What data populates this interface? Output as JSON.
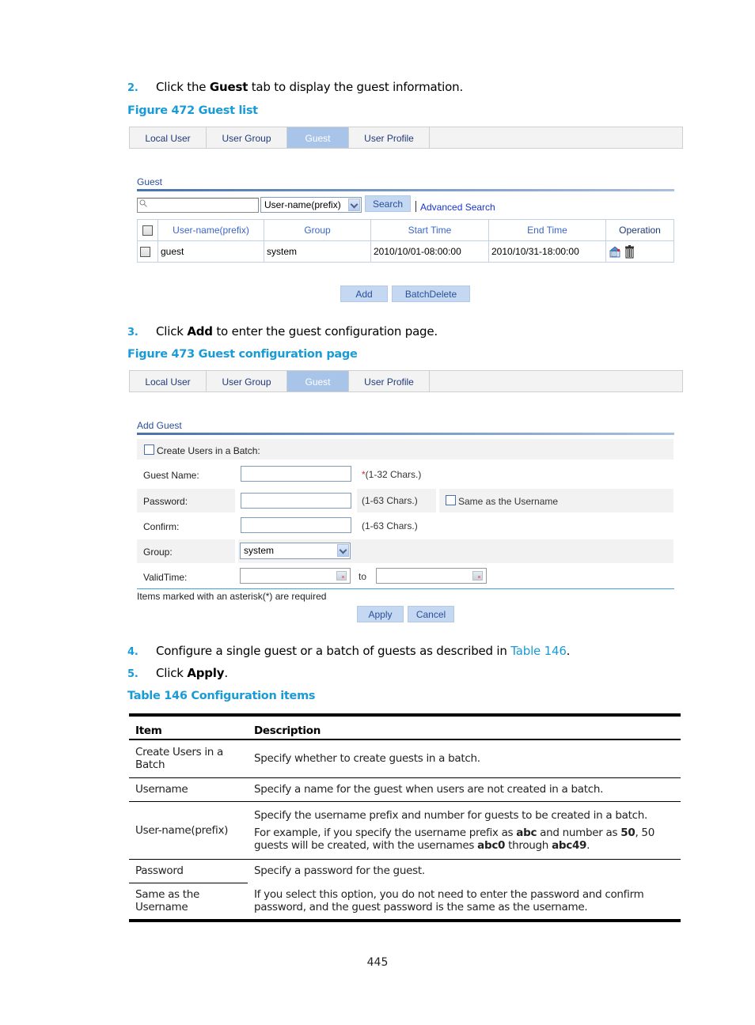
{
  "steps": {
    "s2": {
      "num": "2.",
      "pre": "Click the ",
      "bold": "Guest",
      "post": " tab to display the guest information."
    },
    "s3": {
      "num": "3.",
      "pre": "Click ",
      "bold": "Add",
      "post": " to enter the guest configuration page."
    },
    "s4": {
      "num": "4.",
      "pre": "Configure a single guest or a batch of guests as described in ",
      "link": "Table 146",
      "post": "."
    },
    "s5": {
      "num": "5.",
      "pre": "Click ",
      "bold": "Apply",
      "post": "."
    }
  },
  "captions": {
    "fig472": "Figure 472 Guest list",
    "fig473": "Figure 473 Guest configuration page",
    "table146": "Table 146 Configuration items"
  },
  "tabs": [
    "Local User",
    "User Group",
    "Guest",
    "User Profile"
  ],
  "active_tab": "Guest",
  "guest_list": {
    "section_title": "Guest",
    "search": {
      "value": "",
      "field_select": "User-name(prefix)",
      "search_button": "Search",
      "advanced_link": "Advanced Search"
    },
    "columns": [
      "User-name(prefix)",
      "Group",
      "Start Time",
      "End Time",
      "Operation"
    ],
    "rows": [
      {
        "username": "guest",
        "group": "system",
        "start": "2010/10/01-08:00:00",
        "end": "2010/10/31-18:00:00",
        "operations": [
          "edit-icon",
          "delete-icon"
        ]
      }
    ],
    "buttons": {
      "add": "Add",
      "batch_delete": "BatchDelete"
    }
  },
  "add_guest": {
    "section_title": "Add Guest",
    "batch_checkbox": "Create Users in a Batch:",
    "guest_name": {
      "label": "Guest Name:",
      "value": "",
      "required_mark": "*",
      "hint": "(1-32 Chars.)"
    },
    "password": {
      "label": "Password:",
      "value": "",
      "hint": "(1-63 Chars.)",
      "same_checkbox": "Same as the Username"
    },
    "confirm": {
      "label": "Confirm:",
      "value": "",
      "hint": "(1-63 Chars.)"
    },
    "group": {
      "label": "Group:",
      "selected": "system"
    },
    "valid_time": {
      "label": "ValidTime:",
      "from": "",
      "to_label": "to",
      "to": ""
    },
    "required_note": "Items marked with an asterisk(*) are required",
    "buttons": {
      "apply": "Apply",
      "cancel": "Cancel"
    }
  },
  "config_table": {
    "headers": [
      "Item",
      "Description"
    ],
    "rows": [
      {
        "item": "Create Users in a Batch",
        "desc": [
          "Specify whether to create guests in a batch."
        ]
      },
      {
        "item": "Username",
        "desc": [
          "Specify a name for the guest when users are not created in a batch."
        ]
      },
      {
        "item": "User-name(prefix)",
        "desc": [
          "Specify the username prefix and number for guests to be created in a batch."
        ],
        "example": {
          "t1": "For example, if you specify the username prefix as ",
          "b1": "abc",
          "t2": " and number as ",
          "b2": "50",
          "t3": ", 50 guests will be created, with the usernames ",
          "b3": "abc0",
          "t4": " through ",
          "b4": "abc49",
          "t5": "."
        }
      },
      {
        "item": "Password",
        "desc": [
          "Specify a password for the guest."
        ]
      },
      {
        "item": "Same as the Username",
        "desc": [
          "If you select this option, you do not need to enter the password and confirm password, and the guest password is the same as the username."
        ]
      }
    ]
  },
  "page_number": "445"
}
